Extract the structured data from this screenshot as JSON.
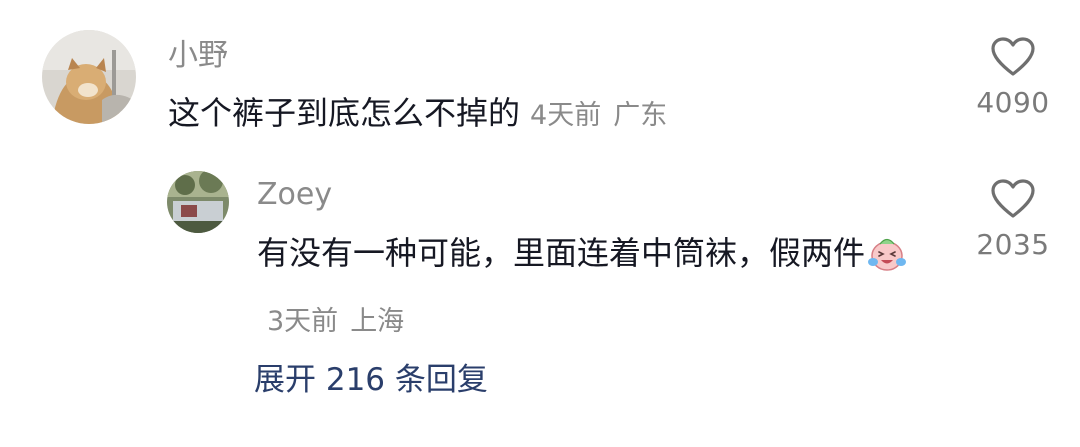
{
  "comment": {
    "username": "小野",
    "text": "这个裤子到底怎么不掉的",
    "time": "4天前",
    "location": "广东",
    "likes": "4090"
  },
  "reply": {
    "username": "Zoey",
    "text": "有没有一种可能，里面连着中筒袜，假两件",
    "emoji": "crying-laughing-face",
    "time": "3天前",
    "location": "上海",
    "likes": "2035"
  },
  "expand_replies": {
    "label": "展开 216 条回复"
  },
  "colors": {
    "username": "#8a8a8a",
    "body_text": "#161823",
    "meta": "#8a8a8a",
    "link": "#2a3e6b",
    "like_icon": "#6f6f6f"
  },
  "icons": {
    "like": "heart-outline-icon"
  }
}
